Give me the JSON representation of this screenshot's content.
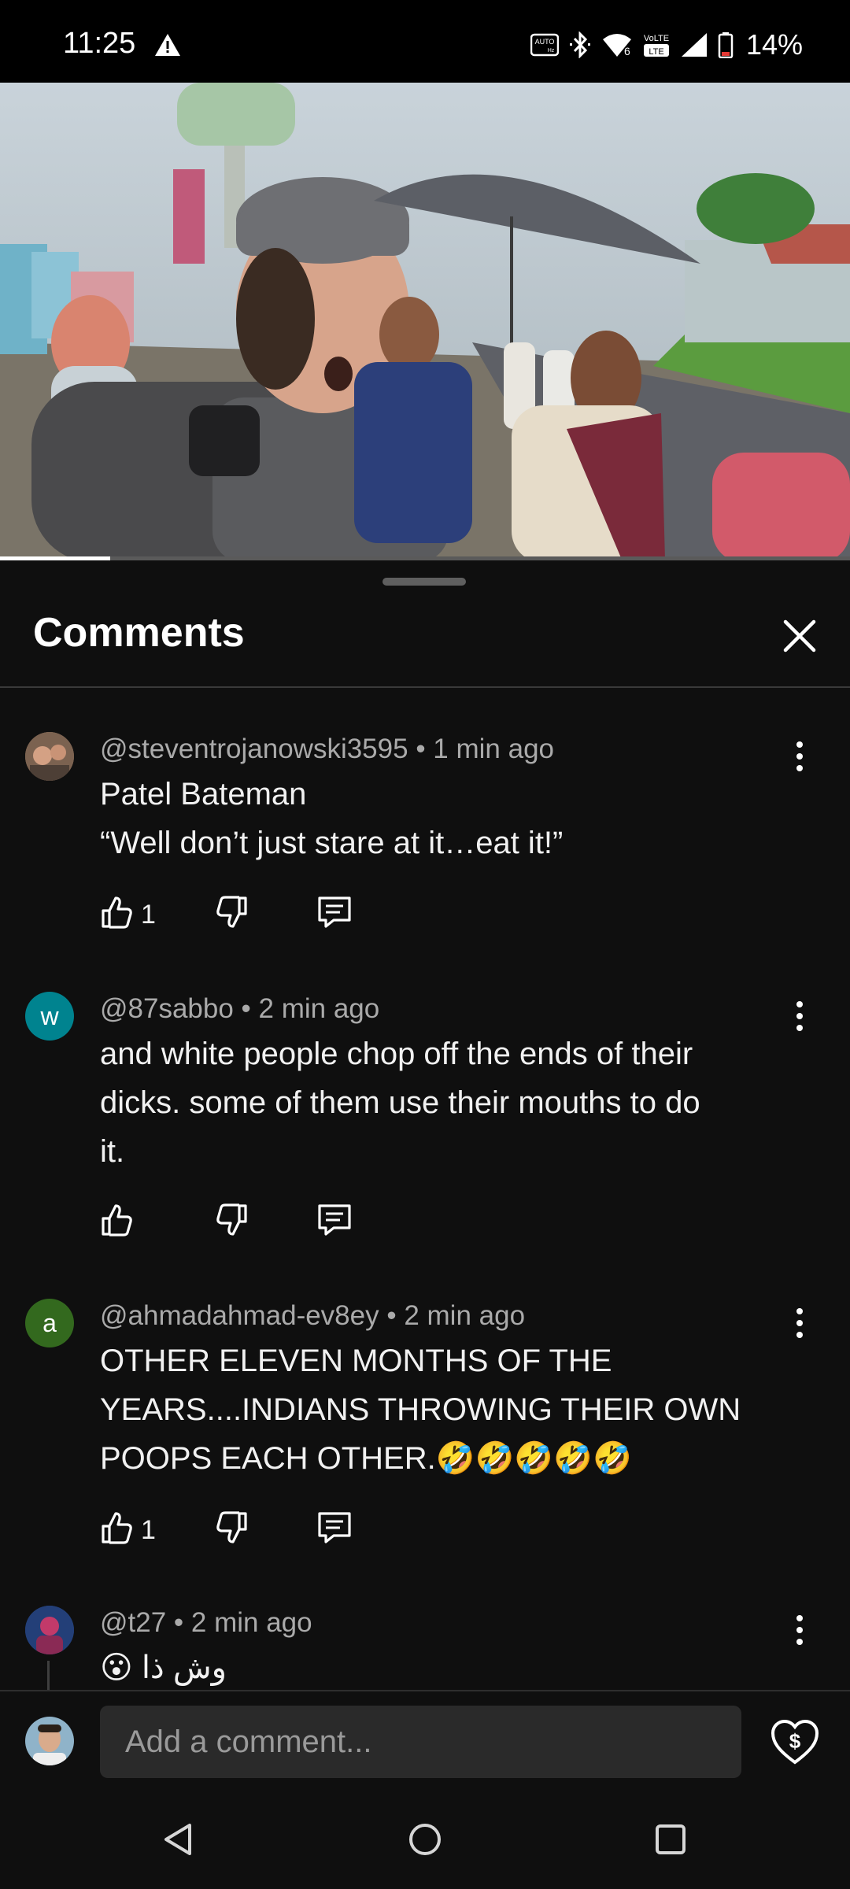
{
  "status_bar": {
    "time": "11:25",
    "battery": "14%",
    "icons": [
      "warning-icon",
      "auto-hz-icon",
      "bluetooth-icon",
      "wifi-6-icon",
      "volte-icon",
      "signal-icon",
      "battery-icon"
    ]
  },
  "video": {
    "progress_fraction": 0.13
  },
  "sheet": {
    "title": "Comments",
    "close_icon": "close-icon"
  },
  "comments": [
    {
      "handle": "@steventrojanowski3595",
      "time": "1 min ago",
      "avatar": "photo",
      "lines": [
        "Patel Bateman",
        "“Well don’t just stare at it…eat it!”"
      ],
      "likes": "1"
    },
    {
      "handle": "@87sabbo",
      "time": "2 min ago",
      "avatar_letter": "w",
      "avatar_color": "#00838f",
      "lines": [
        "and white people chop off the ends of their",
        "dicks. some of them use their mouths to do",
        "it."
      ],
      "likes": ""
    },
    {
      "handle": "@ahmadahmad-ev8ey",
      "time": "2 min ago",
      "avatar_letter": "a",
      "avatar_color": "#33691e",
      "lines": [
        "OTHER ELEVEN MONTHS OF THE",
        "YEARS....INDIANS THROWING THEIR OWN",
        "POOPS EACH OTHER.🤣🤣🤣🤣🤣"
      ],
      "likes": "1"
    },
    {
      "handle": "@t27",
      "time": "2 min ago",
      "avatar": "photo",
      "lines": [
        "😮 وش ذا"
      ],
      "likes": ""
    }
  ],
  "separator": " • ",
  "input": {
    "placeholder": "Add a comment..."
  },
  "nav": [
    "back-icon",
    "home-icon",
    "recents-icon"
  ]
}
